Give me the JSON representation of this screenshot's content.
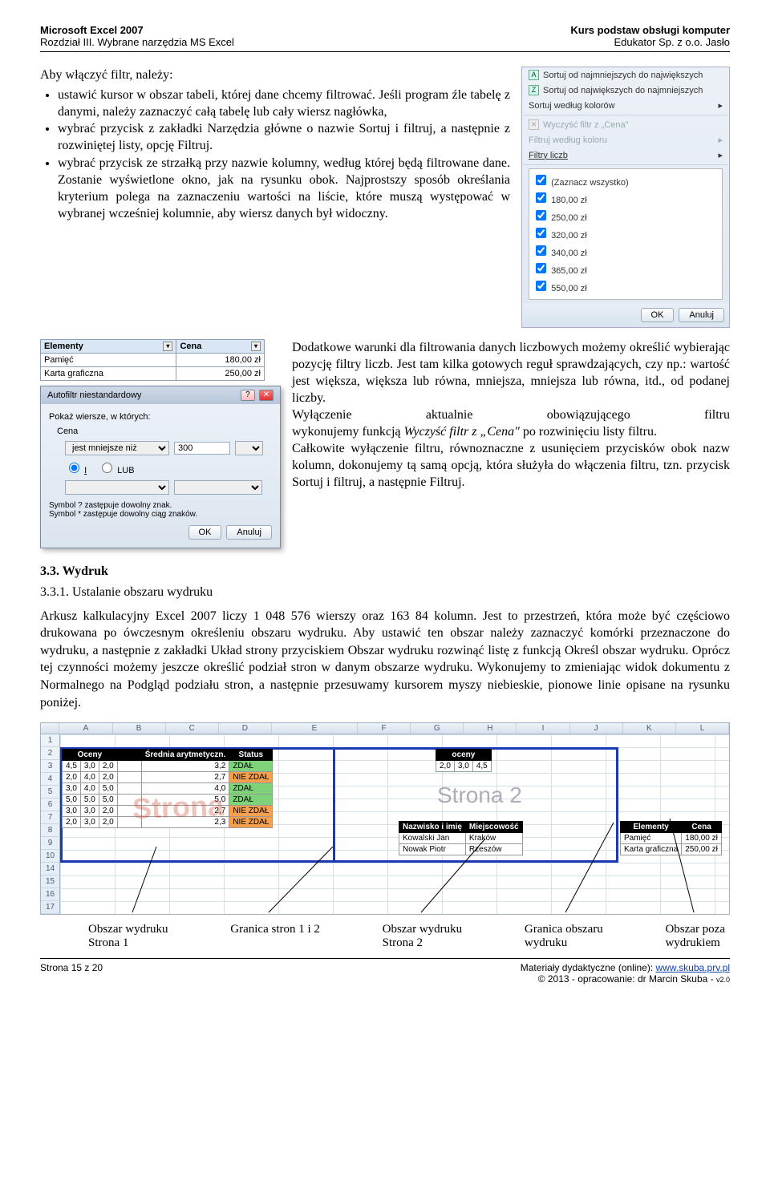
{
  "header": {
    "left1": "Microsoft Excel 2007",
    "right1": "Kurs podstaw obsługi komputer",
    "left2": "Rozdział III. Wybrane narzędzia MS Excel",
    "right2": "Edukator Sp. z o.o. Jasło"
  },
  "intro": {
    "lead": "Aby włączyć filtr, należy:",
    "b1": "ustawić kursor w obszar tabeli, której dane chcemy filtrować. Jeśli program źle tabelę z danymi, należy zaznaczyć całą tabelę lub cały wiersz nagłówka,",
    "b2": "wybrać przycisk z zakładki Narzędzia główne o nazwie Sortuj i filtruj, a następnie z rozwiniętej listy, opcję Filtruj.",
    "b3": "wybrać przycisk ze strzałką przy nazwie kolumny, według której będą filtrowane dane. Zostanie wyświetlone okno, jak na rysunku obok. Najprostszy sposób określania kryterium polega na zaznaczeniu wartości na liście, które muszą występować w wybranej wcześniej kolumnie, aby wiersz danych był widoczny."
  },
  "filterPanel": {
    "row1": "Sortuj od najmniejszych do największych",
    "row2": "Sortuj od największych do najmniejszych",
    "row3": "Sortuj według kolorów",
    "row4": "Wyczyść filtr z „Cena\"",
    "row5": "Filtruj według koloru",
    "row6": "Filtry liczb",
    "chkAll": "(Zaznacz wszystko)",
    "v1": "180,00 zł",
    "v2": "250,00 zł",
    "v3": "320,00 zł",
    "v4": "340,00 zł",
    "v5": "365,00 zł",
    "v6": "550,00 zł",
    "ok": "OK",
    "cancel": "Anuluj"
  },
  "miniTable": {
    "h1": "Elementy",
    "h2": "Cena",
    "r1c1": "Pamięć",
    "r1c2": "180,00 zł",
    "r2c1": "Karta graficzna",
    "r2c2": "250,00 zł"
  },
  "dialog": {
    "title": "Autofiltr niestandardowy",
    "line1": "Pokaż wiersze, w których:",
    "field": "Cena",
    "op": "jest mniejsze niż",
    "val": "300",
    "radI": "I",
    "radLUB": "LUB",
    "hint1": "Symbol ? zastępuje dowolny znak.",
    "hint2": "Symbol * zastępuje dowolny ciąg znaków.",
    "ok": "OK",
    "cancel": "Anuluj"
  },
  "para2": {
    "p1": "Dodatkowe warunki dla filtrowania danych liczbowych możemy określić wybierając pozycję filtry liczb. Jest tam kilka gotowych reguł sprawdzających, czy np.: wartość jest większa, większa lub równa, mniejsza, mniejsza lub równa, itd., od podanej liczby.",
    "p2a": "Wyłączenie",
    "p2b": "aktualnie",
    "p2c": "obowiązującego",
    "p2d": "filtru",
    "p2e": "wykonujemy funkcją ",
    "p2f": "Wyczyść filtr z „Cena\"",
    "p2g": " po rozwinięciu listy filtru.",
    "p3": "Całkowite wyłączenie filtru, równoznaczne z usunięciem przycisków obok nazw kolumn, dokonujemy tą samą opcją, która służyła do włączenia filtru, tzn. przycisk Sortuj i filtruj, a następnie Filtruj."
  },
  "sec33": "3.3. Wydruk",
  "sec331": "3.3.1. Ustalanie obszaru wydruku",
  "para3": "Arkusz kalkulacyjny Excel 2007 liczy 1 048 576 wierszy oraz 163 84 kolumn. Jest to przestrzeń, która może być częściowo drukowana po ówczesnym określeniu  obszaru wydruku. Aby ustawić ten obszar należy zaznaczyć komórki przeznaczone do wydruku, a następnie z zakładki Układ strony przyciskiem Obszar wydruku  rozwinąć listę z funkcją Określ obszar wydruku. Oprócz tej czynności możemy jeszcze określić podział stron w danym obszarze wydruku. Wykonujemy to zmieniając widok dokumentu z Normalnego na Podgląd podziału stron, a następnie przesuwamy kursorem myszy niebieskie, pionowe linie opisane na rysunku poniżej.",
  "excel": {
    "cols": [
      "A",
      "B",
      "C",
      "D",
      "E",
      "F",
      "G",
      "H",
      "I",
      "J",
      "K",
      "L"
    ],
    "rows": [
      "1",
      "2",
      "3",
      "4",
      "5",
      "6",
      "7",
      "8",
      "9",
      "10",
      "14",
      "15",
      "16",
      "17"
    ],
    "oceny_h": [
      "Oceny",
      "",
      "",
      "",
      "Średnia arytmetyczn.",
      "Status"
    ],
    "oceny": [
      [
        "4,5",
        "3,0",
        "2,0",
        "",
        "3,2",
        "ZDAŁ"
      ],
      [
        "2,0",
        "4,0",
        "2,0",
        "",
        "2,7",
        "NIE ZDAŁ"
      ],
      [
        "3,0",
        "4,0",
        "5,0",
        "",
        "4,0",
        "ZDAŁ"
      ],
      [
        "5,0",
        "5,0",
        "5,0",
        "",
        "5,0",
        "ZDAŁ"
      ],
      [
        "3,0",
        "3,0",
        "2,0",
        "",
        "2,7",
        "NIE ZDAŁ"
      ],
      [
        "2,0",
        "3,0",
        "2,0",
        "",
        "2,3",
        "NIE ZDAŁ"
      ]
    ],
    "oceny2_h": [
      "oceny",
      "",
      ""
    ],
    "oceny2": [
      [
        "2,0",
        "3,0",
        "4,5"
      ]
    ],
    "nm_h": [
      "Nazwisko i imię",
      "Miejscowość"
    ],
    "nm": [
      [
        "Kowalski Jan",
        "Kraków"
      ],
      [
        "Nowak Piotr",
        "Rzeszów"
      ]
    ],
    "el_h": [
      "Elementy",
      "Cena"
    ],
    "el": [
      [
        "Pamięć",
        "180,00 zł"
      ],
      [
        "Karta graficzna",
        "250,00 zł"
      ]
    ],
    "watermark": "Strona",
    "strona2": "Strona 2"
  },
  "annot": {
    "a1a": "Obszar wydruku",
    "a1b": "Strona 1",
    "a2": "Granica stron 1 i 2",
    "a3a": "Obszar wydruku",
    "a3b": "Strona 2",
    "a4a": "Granica obszaru",
    "a4b": "wydruku",
    "a5a": "Obszar poza",
    "a5b": "wydrukiem"
  },
  "footer": {
    "left": "Strona 15 z 20",
    "right1": "Materiały dydaktyczne  (online):  ",
    "link": "www.skuba.prv.pl",
    "right2": "© 2013 - opracowanie: dr Marcin Skuba - ",
    "ver": "v2.0"
  }
}
